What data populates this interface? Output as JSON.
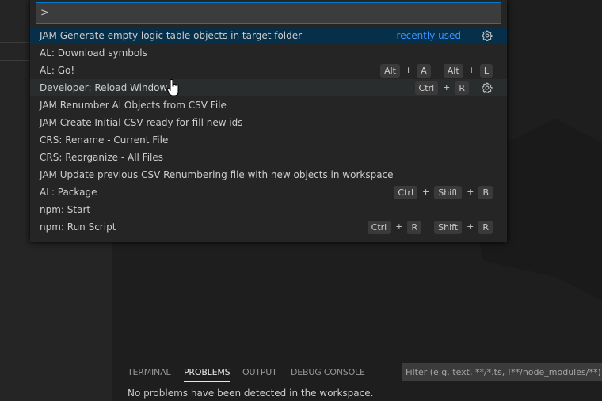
{
  "quick_pick": {
    "input_value": ">",
    "items": [
      {
        "label": "JAM Generate empty logic table objects in target folder",
        "badge": "recently used",
        "gear": true,
        "state": "selected"
      },
      {
        "label": "AL: Download symbols"
      },
      {
        "label": "AL: Go!",
        "keys": [
          [
            "Alt",
            "A"
          ],
          [
            "Alt",
            "L"
          ]
        ]
      },
      {
        "label": "Developer: Reload Window",
        "keys": [
          [
            "Ctrl",
            "R"
          ]
        ],
        "gear": true,
        "state": "hover"
      },
      {
        "label": "JAM Renumber Al Objects from CSV File"
      },
      {
        "label": "JAM Create Initial CSV ready for fill new ids"
      },
      {
        "label": "CRS: Rename - Current File"
      },
      {
        "label": "CRS: Reorganize - All Files"
      },
      {
        "label": "JAM Update previous CSV Renumbering file with new objects in workspace"
      },
      {
        "label": "AL: Package",
        "keys": [
          [
            "Ctrl",
            "Shift",
            "B"
          ]
        ]
      },
      {
        "label": "npm: Start"
      },
      {
        "label": "npm: Run Script",
        "keys": [
          [
            "Ctrl",
            "R"
          ],
          [
            "Shift",
            "R"
          ]
        ]
      }
    ]
  },
  "panel": {
    "tabs": [
      "TERMINAL",
      "PROBLEMS",
      "OUTPUT",
      "DEBUG CONSOLE"
    ],
    "active_tab": "PROBLEMS",
    "filter_placeholder": "Filter (e.g. text, **/*.ts, !**/node_modules/**)",
    "message": "No problems have been detected in the workspace."
  },
  "colors": {
    "accent": "#007acc",
    "selected_row": "#062f4a",
    "badge": "#3794ff"
  }
}
